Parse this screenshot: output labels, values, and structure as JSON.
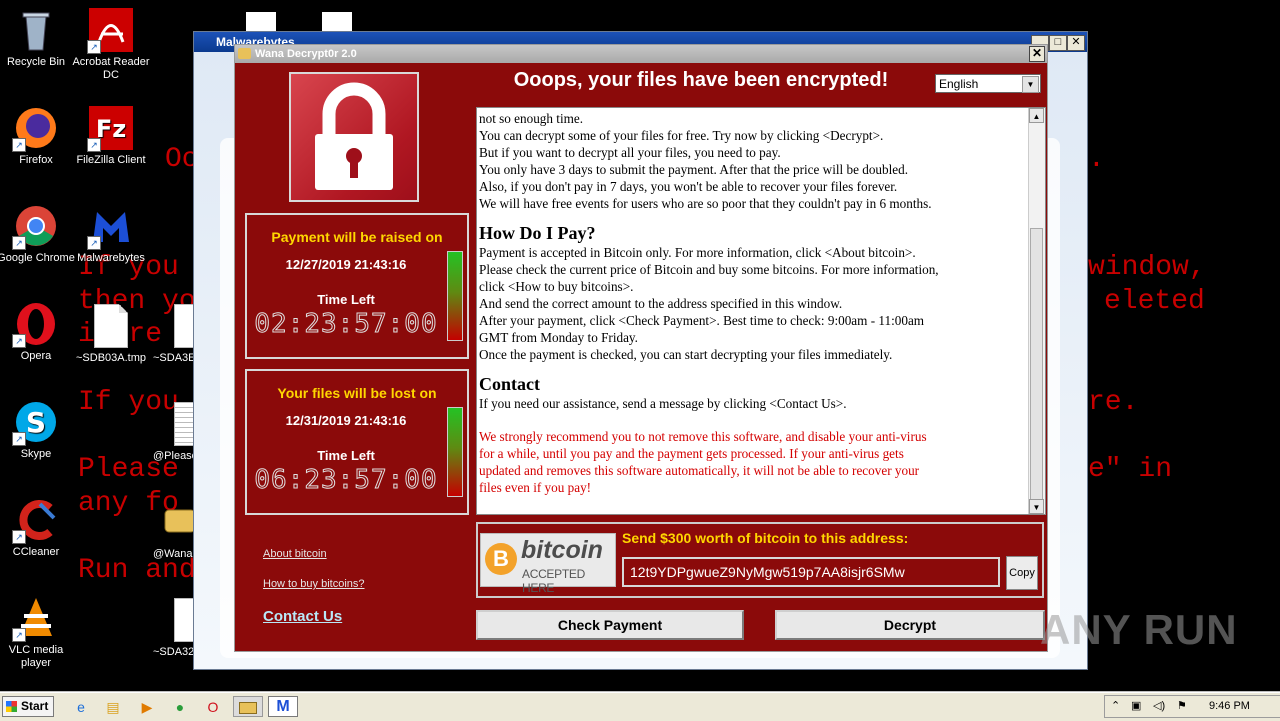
{
  "desktop": {
    "bg_lines": [
      {
        "text": "Oo",
        "note": ""
      },
      {
        "text": "If you",
        "note": ""
      },
      {
        "text": "then yo",
        "note": ""
      },
      {
        "text": "i fre",
        "note": ""
      },
      {
        "text": "If you",
        "note": ""
      },
      {
        "text": "Please",
        "note": ""
      },
      {
        "text": "any fo",
        "note": ""
      },
      {
        "text": "Run and",
        "note": ""
      },
      {
        "text": "window,",
        "note": ""
      },
      {
        "text": "eleted",
        "note": ""
      },
      {
        "text": "re.",
        "note": ""
      },
      {
        "text": "e\" in",
        "note": ""
      },
      {
        "text": ".",
        "note": ""
      }
    ],
    "icons": [
      {
        "label": "Recycle Bin",
        "icon": "recycle-bin-icon"
      },
      {
        "label": "Acrobat Reader DC",
        "icon": "acrobat-icon"
      },
      {
        "label": "Firefox",
        "icon": "firefox-icon"
      },
      {
        "label": "FileZilla Client",
        "icon": "filezilla-icon"
      },
      {
        "label": "Google Chrome",
        "icon": "chrome-icon"
      },
      {
        "label": "Malwarebytes",
        "icon": "malwarebytes-icon"
      },
      {
        "label": "Opera",
        "icon": "opera-icon"
      },
      {
        "label": "~SDB03A.tmp",
        "icon": "file-icon"
      },
      {
        "label": "~SDA3E",
        "icon": "file-icon"
      },
      {
        "label": "Skype",
        "icon": "skype-icon"
      },
      {
        "label": "@Please",
        "icon": "text-file-icon"
      },
      {
        "label": "CCleaner",
        "icon": "ccleaner-icon"
      },
      {
        "label": "@Wana",
        "icon": "wana-icon"
      },
      {
        "label": "VLC media player",
        "icon": "vlc-icon"
      },
      {
        "label": "~SDA32",
        "icon": "file-icon"
      }
    ]
  },
  "back_window": {
    "title": "Malwarebytes"
  },
  "wana": {
    "title": "Wana Decrypt0r 2.0",
    "headline": "Ooops, your files have been encrypted!",
    "language": "English",
    "timer1": {
      "title": "Payment will be raised on",
      "date": "12/27/2019 21:43:16",
      "time_left_label": "Time Left",
      "clock": "02:23:57:00"
    },
    "timer2": {
      "title": "Your files will be lost on",
      "date": "12/31/2019 21:43:16",
      "time_left_label": "Time Left",
      "clock": "06:23:57:00"
    },
    "links": {
      "about_bitcoin": "About bitcoin",
      "how_to_buy": "How to buy bitcoins?",
      "contact_us": "Contact Us"
    },
    "message": {
      "intro_lines": [
        "not so enough time.",
        "You can decrypt some of your files for free. Try now by clicking <Decrypt>.",
        "But if you want to decrypt all your files, you need to pay.",
        "You only have 3 days to submit the payment. After that the price will be doubled.",
        "Also, if you don't pay in 7 days, you won't be able to recover your files forever.",
        "We will have free events for users who are so poor that they couldn't pay in 6 months."
      ],
      "pay_heading": "How Do I Pay?",
      "pay_lines": [
        "Payment is accepted in Bitcoin only. For more information, click <About bitcoin>.",
        "Please check the current price of Bitcoin and buy some bitcoins. For more information,",
        "click <How to buy bitcoins>.",
        "And send the correct amount to the address specified in this window.",
        "After your payment, click <Check Payment>. Best time to check: 9:00am - 11:00am",
        "GMT from Monday to Friday.",
        "Once the payment is checked, you can start decrypting your files immediately."
      ],
      "contact_heading": "Contact",
      "contact_line": "If you need our assistance, send a message by clicking <Contact Us>.",
      "warning_lines": [
        "We strongly recommend you to not remove this software, and disable your anti-virus",
        "for a while, until you pay and the payment gets processed. If your anti-virus gets",
        "updated and removes this software automatically, it will not be able to recover your",
        "files even if you pay!"
      ]
    },
    "payment": {
      "bitcoin_word": "bitcoin",
      "bitcoin_sub": "ACCEPTED HERE",
      "send_label": "Send $300 worth of bitcoin to this address:",
      "address": "12t9YDPgwueZ9NyMgw519p7AA8isjr6SMw",
      "copy_label": "Copy"
    },
    "buttons": {
      "check_payment": "Check Payment",
      "decrypt": "Decrypt"
    }
  },
  "taskbar": {
    "start_label": "Start",
    "clock": "9:46 PM"
  },
  "watermark": "ANY RUN",
  "colors": {
    "wana_bg": "#8b0a0a",
    "timer_title": "#ffd700",
    "warning_text": "#d40000",
    "bg_text": "#c80000"
  }
}
